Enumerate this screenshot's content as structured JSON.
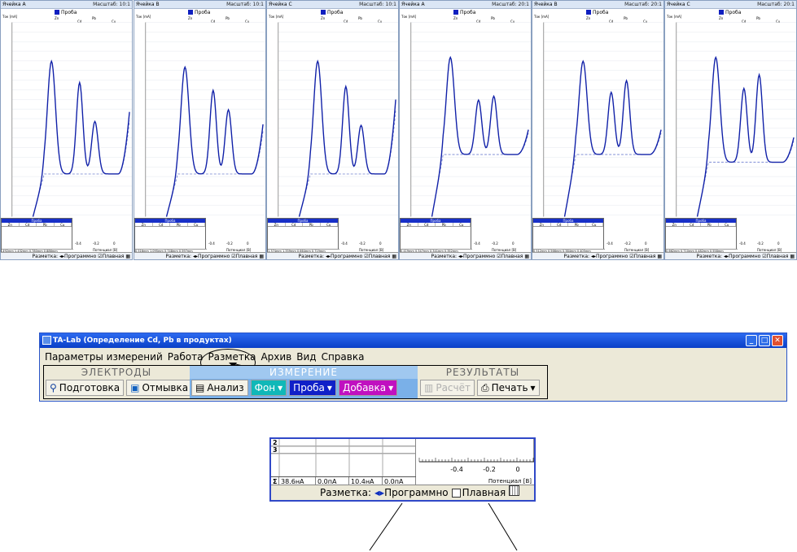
{
  "panels": [
    {
      "cell": "Ячейка A",
      "scale": "Масштаб: 10:1",
      "legend": "Проба",
      "unit": "Ток [mA]",
      "foot": "-492mm 1,432mm 0,780mm 0,886mm"
    },
    {
      "cell": "Ячейка B",
      "scale": "Масштаб: 10:1",
      "legend": "Проба",
      "unit": "Ток [mA]",
      "foot": "0,516mm 1,095mm 0,748mm 0,597mm"
    },
    {
      "cell": "Ячейка C",
      "scale": "Масштаб: 10:1",
      "legend": "Проба",
      "unit": "Ток [mA]",
      "foot": "1,374mm 1,359mm 0,664mm 0,719mm"
    },
    {
      "cell": "Ячейка A",
      "scale": "Масштаб: 20:1",
      "legend": "Проба",
      "unit": "Ток [mA]",
      "foot": "0,419mm 0,347mm 0,341mm 0,352mm"
    },
    {
      "cell": "Ячейка B",
      "scale": "Масштаб: 20:1",
      "legend": "Проба",
      "unit": "Ток [mA]",
      "foot": "0,512mm 0,566mm 0,384mm 0,405mm"
    },
    {
      "cell": "Ячейка C",
      "scale": "Масштаб: 20:1",
      "legend": "Проба",
      "unit": "Ток [mA]",
      "foot": "0,662mm 0,710mm 0,482mm 0,558mm"
    }
  ],
  "panel_common": {
    "table_title": "Проба",
    "cols": [
      "Zn",
      "Cd",
      "Pb",
      "Cu"
    ],
    "ruler": [
      "Zn",
      "Cd",
      "Pb",
      "Cu"
    ],
    "x_ticks": [
      "-0.4",
      "-0.2",
      "0"
    ],
    "x_label": "Потенциал [В]",
    "bar_label": "Разметка:",
    "bar_prog": "Программно",
    "bar_main": "Плавная"
  },
  "app": {
    "title": "TA-Lab (Определение Cd, Pb в продуктах)",
    "menu": [
      "Параметры измерений",
      "Работа",
      "Разметка",
      "Архив",
      "Вид",
      "Справка"
    ],
    "groups": {
      "electrodes": {
        "title": "ЭЛЕКТРОДЫ",
        "buttons": [
          "Подготовка",
          "Отмывка"
        ]
      },
      "measure": {
        "title": "ИЗМЕРЕНИЕ",
        "buttons": [
          "Анализ",
          "Фон",
          "Проба",
          "Добавка"
        ]
      },
      "results": {
        "title": "РЕЗУЛЬТАТЫ",
        "buttons": [
          "Расчёт",
          "Печать"
        ]
      }
    }
  },
  "zoom": {
    "rows": [
      "2",
      "3"
    ],
    "sum_sign": "Σ",
    "sums": [
      "38.6нА",
      "0.0пА",
      "10.4нА",
      "0.0пА"
    ],
    "x_ticks": [
      "-0.4",
      "-0.2",
      "0"
    ],
    "x_label": "Потенциал [В]",
    "bar_label": "Разметка:",
    "bar_prog": "Программно",
    "bar_main": "Плавная"
  }
}
